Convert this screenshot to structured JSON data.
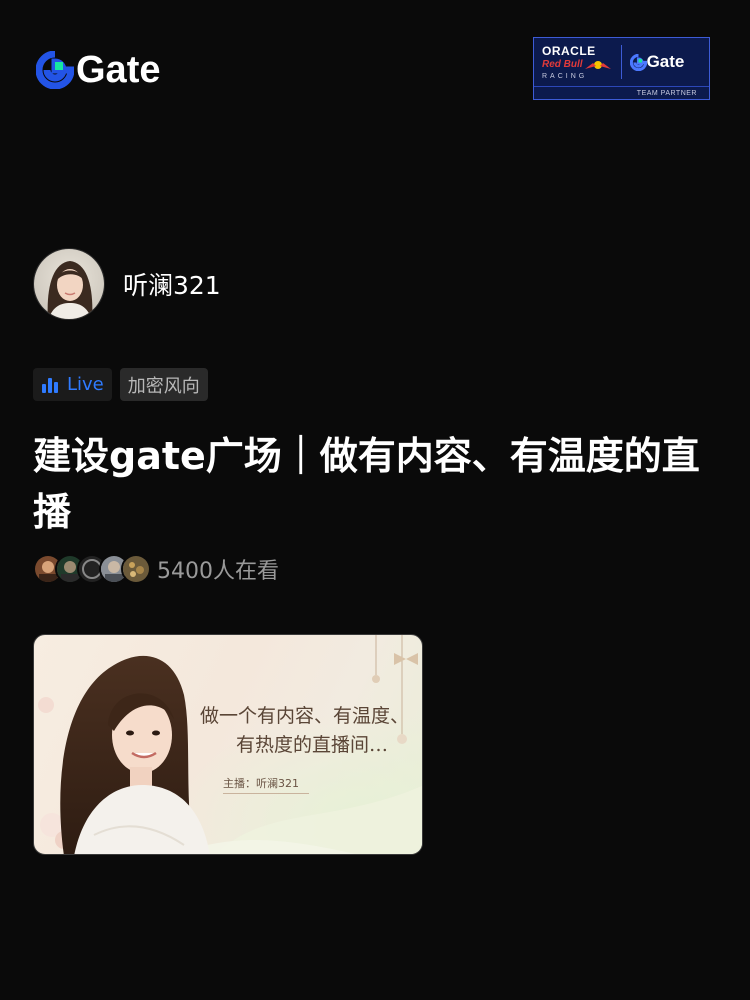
{
  "header": {
    "logo_text": "Gate",
    "partner": {
      "oracle": "ORACLE",
      "redbull": "Red Bull",
      "racing": "RACING",
      "gate": "Gate",
      "footer": "TEAM PARTNER"
    }
  },
  "host": {
    "name": "听澜321"
  },
  "tags": {
    "live_label": "Live",
    "category": "加密风向"
  },
  "stream": {
    "title": "建设gate广场｜做有内容、有温度的直播",
    "viewers_text": "5400人在看"
  },
  "cover": {
    "line1": "做一个有内容、有温度、",
    "line2": "有热度的直播间…",
    "host_label": "主播：听澜321"
  },
  "colors": {
    "background": "#0a0a0a",
    "live_blue": "#2f7bff",
    "brand_blue": "#2354e6",
    "brand_green": "#17e6a1"
  }
}
